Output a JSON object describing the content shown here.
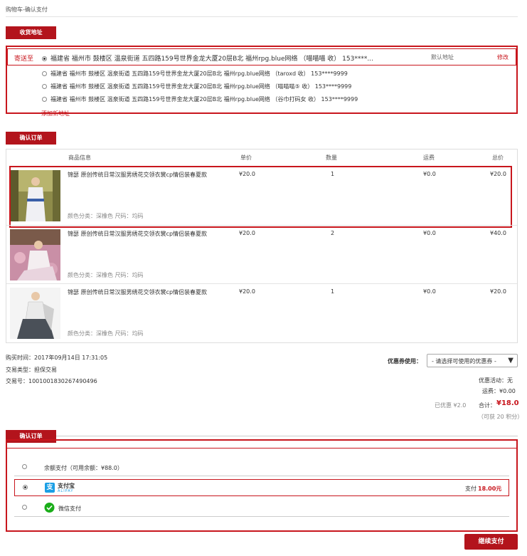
{
  "breadcrumb": "购物车-确认支付",
  "address_section": {
    "title": "收货地址",
    "ship_to_label": "寄送至",
    "default_label": "默认地址",
    "edit_label": "修改",
    "add_label": "添加新地址",
    "addresses": [
      "福建省 福州市 鼓楼区 温泉街道 五四路159号世界金龙大厦20层B北 福州rpg.blue网络 （喵喵喵 收） 153****...",
      "福建省 福州市 鼓楼区 温泉街道 五四路159号世界金龙大厦20层B北 福州rpg.blue网络 （taroxd 收） 153****9999",
      "福建省 福州市 鼓楼区 温泉街道 五四路159号世界金龙大厦20层B北 福州rpg.blue网络 （喵喵喵⑤ 收） 153****9999",
      "福建省 福州市 鼓楼区 温泉街道 五四路159号世界金龙大厦20层B北 福州rpg.blue网络 （谷巾打码女 收） 153****9999"
    ]
  },
  "order_section": {
    "title": "确认订单",
    "headers": {
      "product": "商品信息",
      "price": "单价",
      "qty": "数量",
      "shipping": "运费",
      "total": "总价"
    },
    "items": [
      {
        "name": "锦瑟 原创传统日常汉服男绣花交领衣裳cp情侣装春夏款",
        "attr": "颜色分类：深橡色 尺码：均码",
        "price": "¥20.0",
        "qty": "1",
        "shipping": "¥0.0",
        "total": "¥20.0"
      },
      {
        "name": "锦瑟 原创传统日常汉服男绣花交领衣裳cp情侣装春夏款",
        "attr": "颜色分类：深橡色 尺码：均码",
        "price": "¥20.0",
        "qty": "2",
        "shipping": "¥0.0",
        "total": "¥40.0"
      },
      {
        "name": "锦瑟 原创传统日常汉服男绣花交领衣裳cp情侣装春夏款",
        "attr": "颜色分类：深橡色 尺码：均码",
        "price": "¥20.0",
        "qty": "1",
        "shipping": "¥0.0",
        "total": "¥20.0"
      }
    ]
  },
  "meta": {
    "buy_time": "购买时间：2017年09月14日 17:31:05",
    "trade_type": "交易类型：担保交易",
    "trade_no": "交易号：1001001830267490496"
  },
  "coupon": {
    "label": "优惠券使用：",
    "placeholder": "- 请选择可使用的优惠券 -"
  },
  "summary": {
    "promo": "优惠活动：无",
    "shipping": "运费：¥0.00",
    "discounted": "已优惠 ¥2.0",
    "total_label": "合计：",
    "total_value": "¥18.0",
    "points": "（可获 20 积分）"
  },
  "payment_section": {
    "title": "确认订单",
    "balance": "余额支付（可用余额：¥88.0）",
    "alipay_name": "支付宝",
    "alipay_sub": "ALIPAY",
    "alipay_pay_prefix": "支付",
    "alipay_amount": "18.00元",
    "wechat": "微信支付",
    "continue_button": "继续支付"
  },
  "colors": {
    "accent": "#b3141c",
    "highlight_box": "#c8161d",
    "alipay": "#1a9fe5",
    "wechat": "#1aad19"
  }
}
